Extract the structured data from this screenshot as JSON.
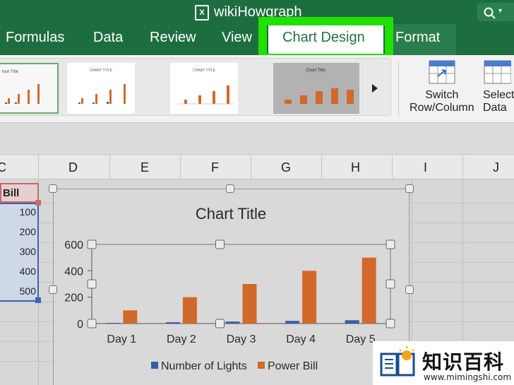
{
  "window": {
    "doc_title": "wikiHowgraph",
    "doc_icon_label": "X",
    "search_icon": "search-icon"
  },
  "tabs": [
    {
      "label": "Formulas"
    },
    {
      "label": "Data"
    },
    {
      "label": "Review"
    },
    {
      "label": "View"
    },
    {
      "label": "Chart Design",
      "active": true
    },
    {
      "label": "Format"
    }
  ],
  "ribbon": {
    "gallery_styles": [
      {
        "title": "hart Title"
      },
      {
        "title": "CHART TITLE"
      },
      {
        "title": "CHART TITLE"
      },
      {
        "title": "Chart Title"
      }
    ],
    "switch_label_1": "Switch",
    "switch_label_2": "Row/Column",
    "select_label_1": "Select",
    "select_label_2": "Data"
  },
  "columns": [
    "C",
    "D",
    "E",
    "F",
    "G",
    "H",
    "I",
    "J"
  ],
  "sheet": {
    "header_cell": "Bill",
    "values": [
      "100",
      "200",
      "300",
      "400",
      "500"
    ]
  },
  "chart_data": {
    "type": "bar",
    "title": "Chart Title",
    "categories": [
      "Day 1",
      "Day 2",
      "Day 3",
      "Day 4",
      "Day 5"
    ],
    "series": [
      {
        "name": "Number of Lights",
        "color": "#3a5ca8",
        "values": [
          5,
          10,
          15,
          20,
          25
        ]
      },
      {
        "name": "Power Bill",
        "color": "#d1692a",
        "values": [
          100,
          200,
          300,
          400,
          500
        ]
      }
    ],
    "ylim": [
      0,
      600
    ],
    "yticks": [
      "0",
      "200",
      "400",
      "600"
    ],
    "legend": "bottom"
  },
  "watermark": {
    "name": "知识百科",
    "url": "www.mimingshi.com"
  }
}
